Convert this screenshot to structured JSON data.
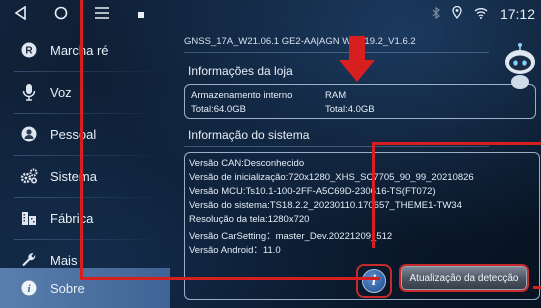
{
  "status_bar": {
    "nav_icons": [
      "back-icon",
      "home-icon",
      "menu-icon",
      "square-icon"
    ],
    "status_icons": [
      "bluetooth-icon",
      "location-icon",
      "wifi-icon"
    ],
    "time": "17:12"
  },
  "sidebar": {
    "items": [
      {
        "label": "Marcha ré",
        "icon": "reverse-icon"
      },
      {
        "label": "Voz",
        "icon": "microphone-icon"
      },
      {
        "label": "Pessoal",
        "icon": "person-icon"
      },
      {
        "label": "Sistema",
        "icon": "gears-icon"
      },
      {
        "label": "Fábrica",
        "icon": "factory-icon"
      },
      {
        "label": "Mais",
        "icon": "wrench-icon"
      },
      {
        "label": "Sobre",
        "icon": "info-icon",
        "active": true
      }
    ]
  },
  "main": {
    "gnss_line": "GNSS_17A_W21.06.1 GE2-AA|AGN    W21.19.2_V1.6.2",
    "store_title": "Informações da loja",
    "storage": {
      "internal_label": "Armazenamento interno",
      "internal_total": "Total:64.0GB",
      "ram_label": "RAM",
      "ram_total": "Total:4.0GB"
    },
    "system_title": "Informação do sistema",
    "system_lines": [
      "Versão CAN:Desconhecido",
      "Versão de inicialização:720x1280_XHS_SC7705_90_99_20210826",
      "Versão MCU:Ts10.1-100-2FF-A5C69D-230616-TS(FT072)",
      "Versão do sistema:TS18.2.2_20230110.170657_THEME1-TW34",
      "Resolução da tela:1280x720",
      "Versão CarSetting：master_Dev.20221209_512",
      "Versão Android：11.0"
    ],
    "info_button_glyph": "i",
    "update_button": "Atualização da detecção"
  },
  "colors": {
    "accent_active": "#4f73a3",
    "annotation_red": "#d71f1f",
    "background": "#0b1a2e"
  }
}
